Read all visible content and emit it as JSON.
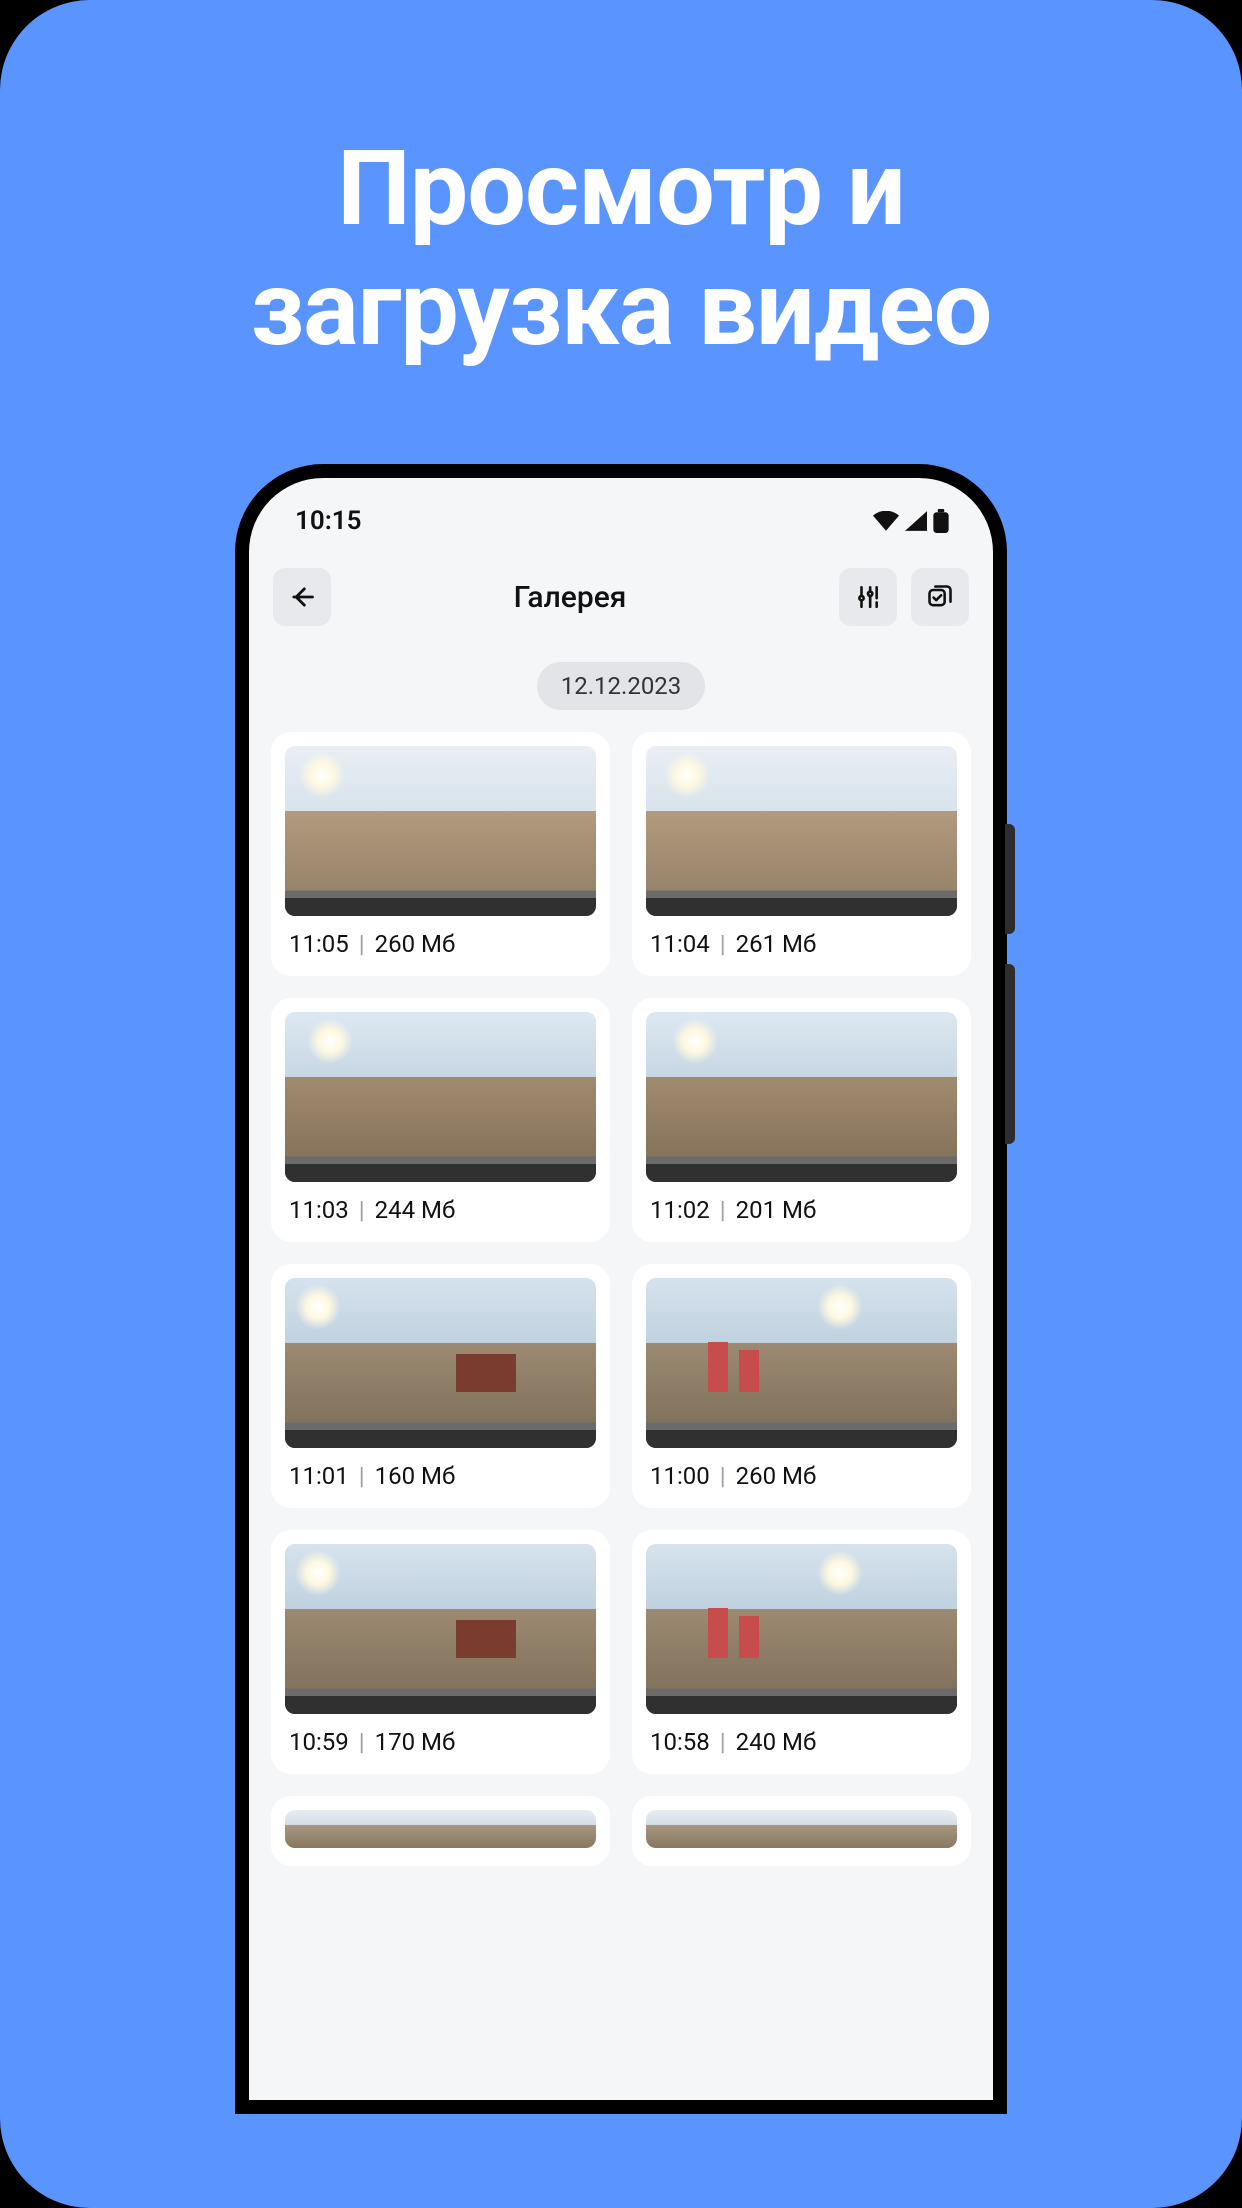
{
  "promo": {
    "title_line1": "Просмотр и",
    "title_line2": "загрузка видео"
  },
  "statusbar": {
    "time": "10:15"
  },
  "toolbar": {
    "title": "Галерея"
  },
  "date": "12.12.2023",
  "items": [
    {
      "time": "11:05",
      "size": "260 Мб"
    },
    {
      "time": "11:04",
      "size": "261 Мб"
    },
    {
      "time": "11:03",
      "size": "244 Мб"
    },
    {
      "time": "11:02",
      "size": "201 Мб"
    },
    {
      "time": "11:01",
      "size": "160 Мб"
    },
    {
      "time": "11:00",
      "size": "260 Мб"
    },
    {
      "time": "10:59",
      "size": "170 Мб"
    },
    {
      "time": "10:58",
      "size": "240 Мб"
    }
  ],
  "meta_separator": "|"
}
